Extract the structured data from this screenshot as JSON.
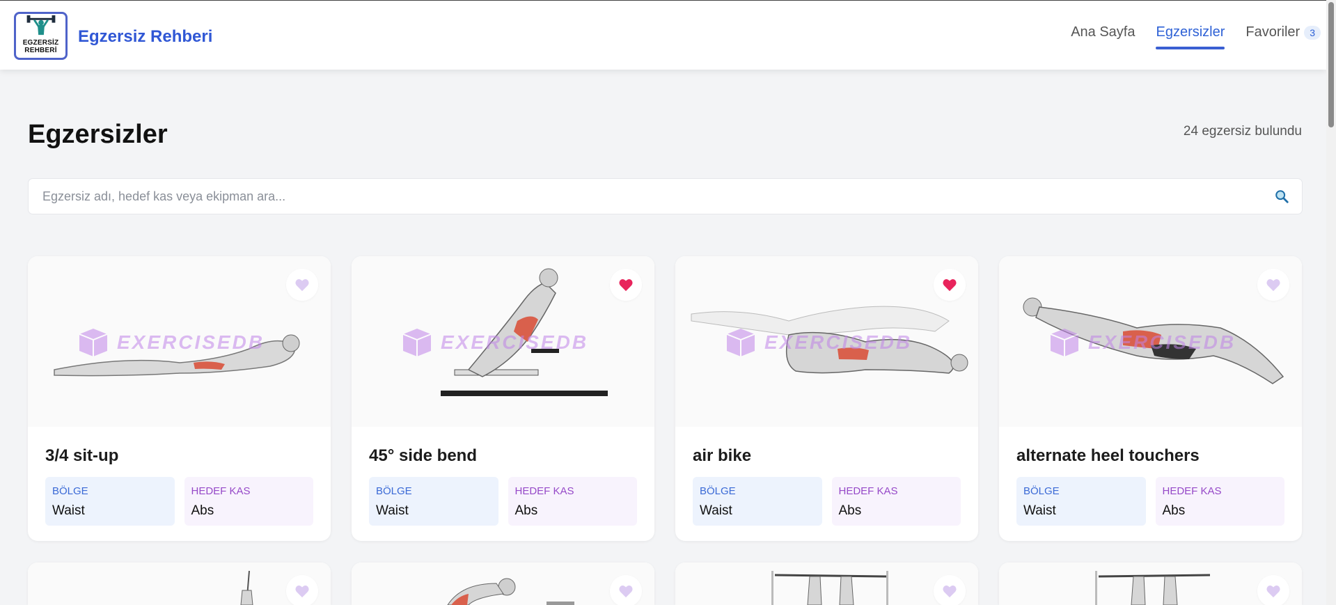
{
  "app": {
    "logo_line1": "EGZERSİZ",
    "logo_line2": "REHBERİ",
    "brand": "Egzersiz Rehberi"
  },
  "nav": {
    "home": "Ana Sayfa",
    "exercises": "Egzersizler",
    "favorites": "Favoriler",
    "favorites_count": "3"
  },
  "page": {
    "title": "Egzersizler",
    "count_text": "24 egzersiz bulundu"
  },
  "search": {
    "placeholder": "Egzersiz adı, hedef kas veya ekipman ara..."
  },
  "watermark": "EXERCISEDB",
  "labels": {
    "region": "BÖLGE",
    "target": "HEDEF KAS"
  },
  "colors": {
    "accent": "#3057d5",
    "favorite_on": "#e8245c",
    "favorite_off": "#d9c6f0"
  },
  "cards": [
    {
      "name": "3/4 sit-up",
      "region": "Waist",
      "target": "Abs",
      "favorite": false
    },
    {
      "name": "45° side bend",
      "region": "Waist",
      "target": "Abs",
      "favorite": true
    },
    {
      "name": "air bike",
      "region": "Waist",
      "target": "Abs",
      "favorite": true
    },
    {
      "name": "alternate heel touchers",
      "region": "Waist",
      "target": "Abs",
      "favorite": false
    },
    {
      "name": "",
      "region": "",
      "target": "",
      "favorite": false
    },
    {
      "name": "",
      "region": "",
      "target": "",
      "favorite": false
    },
    {
      "name": "",
      "region": "",
      "target": "",
      "favorite": false
    },
    {
      "name": "",
      "region": "",
      "target": "",
      "favorite": false
    }
  ]
}
